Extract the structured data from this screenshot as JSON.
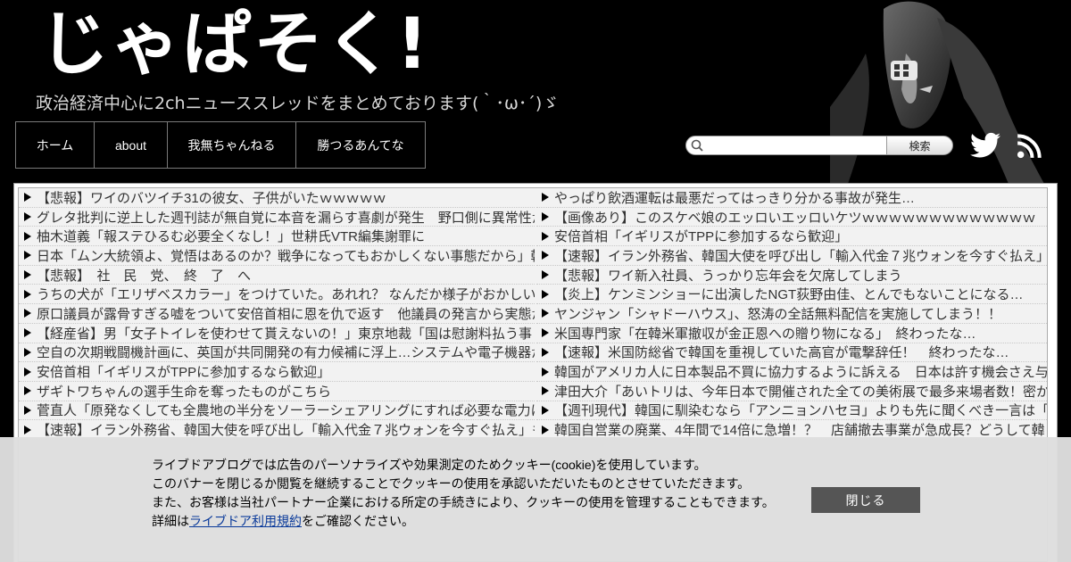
{
  "header": {
    "logo": "じゃぱそく!",
    "tagline": "政治経済中心に2chニューススレッドをまとめております(｀･ω･´)ゞ"
  },
  "nav": {
    "items": [
      {
        "label": "ホーム"
      },
      {
        "label": "about"
      },
      {
        "label": "我無ちゃんねる"
      },
      {
        "label": "勝つるあんてな"
      }
    ]
  },
  "search": {
    "placeholder": "",
    "button_label": "検索"
  },
  "icons": {
    "twitter": "twitter-icon",
    "rss": "rss-icon",
    "search": "search-icon",
    "bullet": "triangle-right-icon"
  },
  "links": {
    "left": [
      "【悲報】ワイのバツイチ31の彼女、子供がいたｗｗｗｗｗ",
      "グレタ批判に逆上した週刊誌が無自覚に本音を漏らす喜劇が発生　野口側に異常性が",
      "柚木道義「報ステひるむ必要全くなし！」世耕氏VTR編集謝罪に",
      "日本「ムン大統領よ、覚悟はあるのか？戦争になってもおかしくない事態だから」韓",
      "【悲報】　社　民　党、　終　了　へ",
      "うちの犬が「エリザベスカラー」をつけていた。あれれ？ なんだか様子がおかしい",
      "原口議員が露骨すぎる嘘をついて安倍首相に恩を仇で返す　他議員の発言から実態が",
      "【経産省】男「女子トイレを使わせて貰えないの！」東京地裁「国は慰謝料払う事",
      "空自の次期戦闘機計画に、英国が共同開発の有力候補に浮上…システムや電子機器が",
      "安倍首相「イギリスがTPPに参加するなら歓迎」",
      "ザギトワちゃんの選手生命を奪ったものがこちら",
      "菅直人「原発なくしても全農地の半分をソーラーシェアリングにすれば必要な電力は",
      "【速報】イラン外務省、韓国大使を呼び出し「輸入代金７兆ウォンを今すぐ払え」も"
    ],
    "right": [
      "やっぱり飲酒運転は最悪だってはっきり分かる事故が発生…",
      "【画像あり】このスケベ娘のエッロいエッロいケツｗｗｗｗｗｗｗｗｗｗｗｗｗ",
      "安倍首相「イギリスがTPPに参加するなら歓迎」",
      "【速報】イラン外務省、韓国大使を呼び出し「輸入代金７兆ウォンを今すぐ払え」",
      "【悲報】ワイ新入社員、うっかり忘年会を欠席してしまう",
      "【炎上】ケンミンショーに出演したNGT荻野由佳、とんでもないことになる…",
      "ヤンジャン「シャドーハウス」、怒涛の全話無料配信を実施してしまう！！",
      "米国専門家「在韓米軍撤収が金正恩への贈り物になる」　終わったな…",
      "【速報】米国防総省で韓国を重視していた高官が電撃辞任！　終わったな…",
      "韓国がアメリカ人に日本製品不買に協力するように訴える　日本は許す機会さえ与",
      "津田大介「あいトリは、今年日本で開催された全ての美術展で最多来場者数！密か",
      "【週刊現代】韓国に馴染むなら「アンニョンハセヨ」よりも先に聞くべき一言は「",
      "韓国自営業の廃業、4年間で14倍に急増！？　店舗撤去事業が急成長？どうして韓"
    ]
  },
  "cookie": {
    "line1": "ライブドアブログでは広告のパーソナライズや効果測定のためクッキー(cookie)を使用しています。",
    "line2": "このバナーを閉じるか閲覧を継続することでクッキーの使用を承認いただいたものとさせていただきます。",
    "line3": "また、お客様は当社パートナー企業における所定の手続きにより、クッキーの使用を管理することもできます。",
    "line4_prefix": "詳細は",
    "line4_link": "ライブドア利用規約",
    "line4_suffix": "をご確認ください。",
    "close_label": "閉じる"
  }
}
